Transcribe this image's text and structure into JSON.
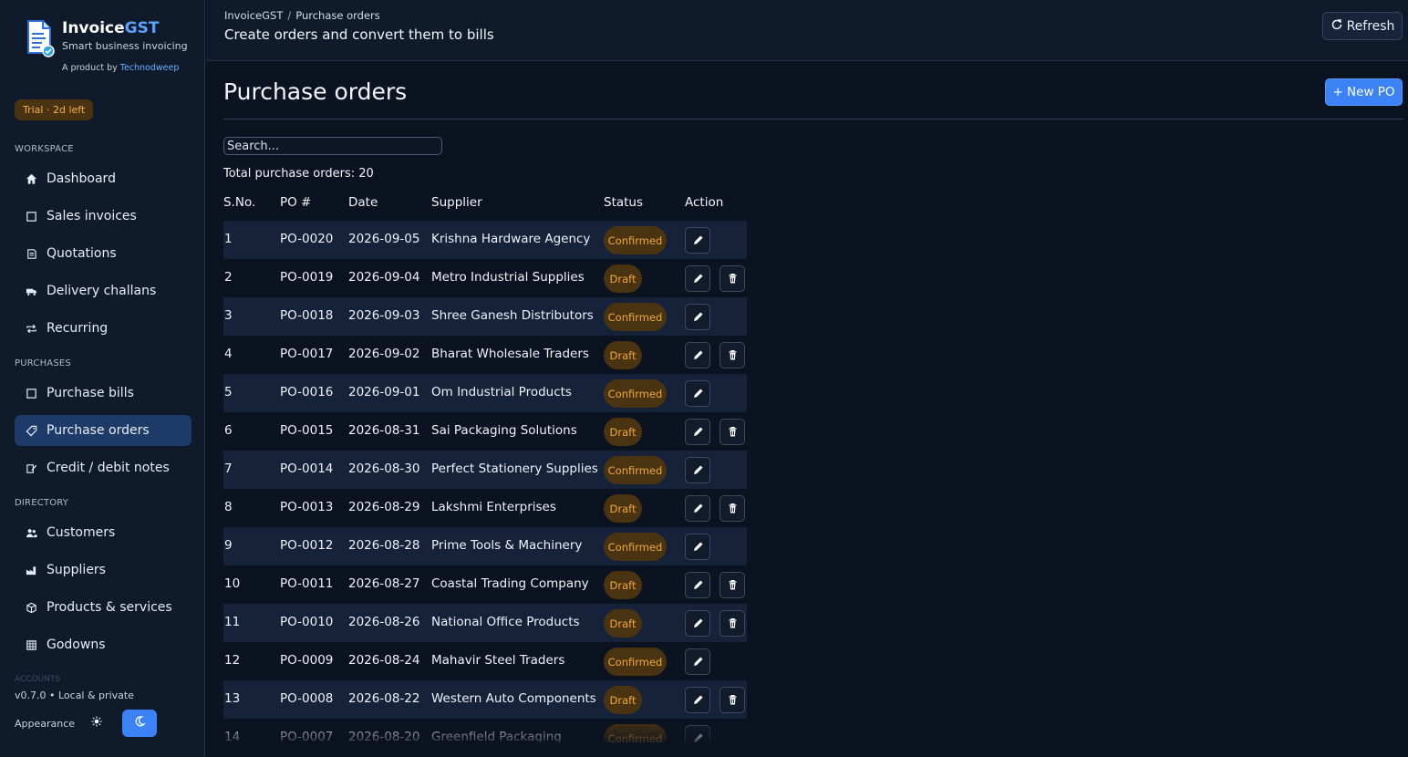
{
  "brand": {
    "name_main": "Invoice",
    "name_accent": "GST",
    "tagline": "Smart business invoicing",
    "by_prefix": "A product by ",
    "by_link": "Technodweep"
  },
  "trial": "Trial · 2d left",
  "sidebar": {
    "sections": {
      "workspace": "WORKSPACE",
      "purchases": "PURCHASES",
      "directory": "DIRECTORY",
      "accounts": "ACCOUNTS"
    },
    "items": [
      {
        "label": "Dashboard",
        "icon": "home-icon"
      },
      {
        "label": "Sales invoices",
        "icon": "square-icon"
      },
      {
        "label": "Quotations",
        "icon": "quotation-icon"
      },
      {
        "label": "Delivery challans",
        "icon": "truck-icon"
      },
      {
        "label": "Recurring",
        "icon": "repeat-icon"
      },
      {
        "label": "Purchase bills",
        "icon": "square-icon"
      },
      {
        "label": "Purchase orders",
        "icon": "tag-icon"
      },
      {
        "label": "Credit / debit notes",
        "icon": "note-icon"
      },
      {
        "label": "Customers",
        "icon": "users-icon"
      },
      {
        "label": "Suppliers",
        "icon": "factory-icon"
      },
      {
        "label": "Products & services",
        "icon": "box-icon"
      },
      {
        "label": "Godowns",
        "icon": "warehouse-icon"
      }
    ],
    "version": "v0.7.0  •  Local & private",
    "appearance": "Appearance"
  },
  "header": {
    "crumb_root": "InvoiceGST",
    "crumb_sep": "/",
    "crumb_current": "Purchase orders",
    "subtitle": "Create orders and convert them to bills",
    "refresh": "Refresh"
  },
  "main": {
    "title": "Purchase orders",
    "new_button": "+ New PO",
    "search_placeholder": "Search...",
    "total": "Total purchase orders: 20",
    "columns": [
      "S.No.",
      "PO #",
      "Date",
      "Supplier",
      "Status",
      "Action"
    ],
    "rows": [
      {
        "sno": "1",
        "po": "PO-0020",
        "date": "2026-09-05",
        "supplier": "Krishna Hardware Agency",
        "status": "Confirmed"
      },
      {
        "sno": "2",
        "po": "PO-0019",
        "date": "2026-09-04",
        "supplier": "Metro Industrial Supplies",
        "status": "Draft"
      },
      {
        "sno": "3",
        "po": "PO-0018",
        "date": "2026-09-03",
        "supplier": "Shree Ganesh Distributors",
        "status": "Confirmed"
      },
      {
        "sno": "4",
        "po": "PO-0017",
        "date": "2026-09-02",
        "supplier": "Bharat Wholesale Traders",
        "status": "Draft"
      },
      {
        "sno": "5",
        "po": "PO-0016",
        "date": "2026-09-01",
        "supplier": "Om Industrial Products",
        "status": "Confirmed"
      },
      {
        "sno": "6",
        "po": "PO-0015",
        "date": "2026-08-31",
        "supplier": "Sai Packaging Solutions",
        "status": "Draft"
      },
      {
        "sno": "7",
        "po": "PO-0014",
        "date": "2026-08-30",
        "supplier": "Perfect Stationery Supplies",
        "status": "Confirmed"
      },
      {
        "sno": "8",
        "po": "PO-0013",
        "date": "2026-08-29",
        "supplier": "Lakshmi Enterprises",
        "status": "Draft"
      },
      {
        "sno": "9",
        "po": "PO-0012",
        "date": "2026-08-28",
        "supplier": "Prime Tools & Machinery",
        "status": "Confirmed"
      },
      {
        "sno": "10",
        "po": "PO-0011",
        "date": "2026-08-27",
        "supplier": "Coastal Trading Company",
        "status": "Draft"
      },
      {
        "sno": "11",
        "po": "PO-0010",
        "date": "2026-08-26",
        "supplier": "National Office Products",
        "status": "Draft"
      },
      {
        "sno": "12",
        "po": "PO-0009",
        "date": "2026-08-24",
        "supplier": "Mahavir Steel Traders",
        "status": "Confirmed"
      },
      {
        "sno": "13",
        "po": "PO-0008",
        "date": "2026-08-22",
        "supplier": "Western Auto Components",
        "status": "Draft"
      },
      {
        "sno": "14",
        "po": "PO-0007",
        "date": "2026-08-20",
        "supplier": "Greenfield Packaging",
        "status": "Confirmed"
      }
    ]
  },
  "colors": {
    "accent": "#3b82f6",
    "badge_bg": "#4a3311",
    "badge_text": "#f0a93b",
    "active_nav": "#1d3a68"
  }
}
